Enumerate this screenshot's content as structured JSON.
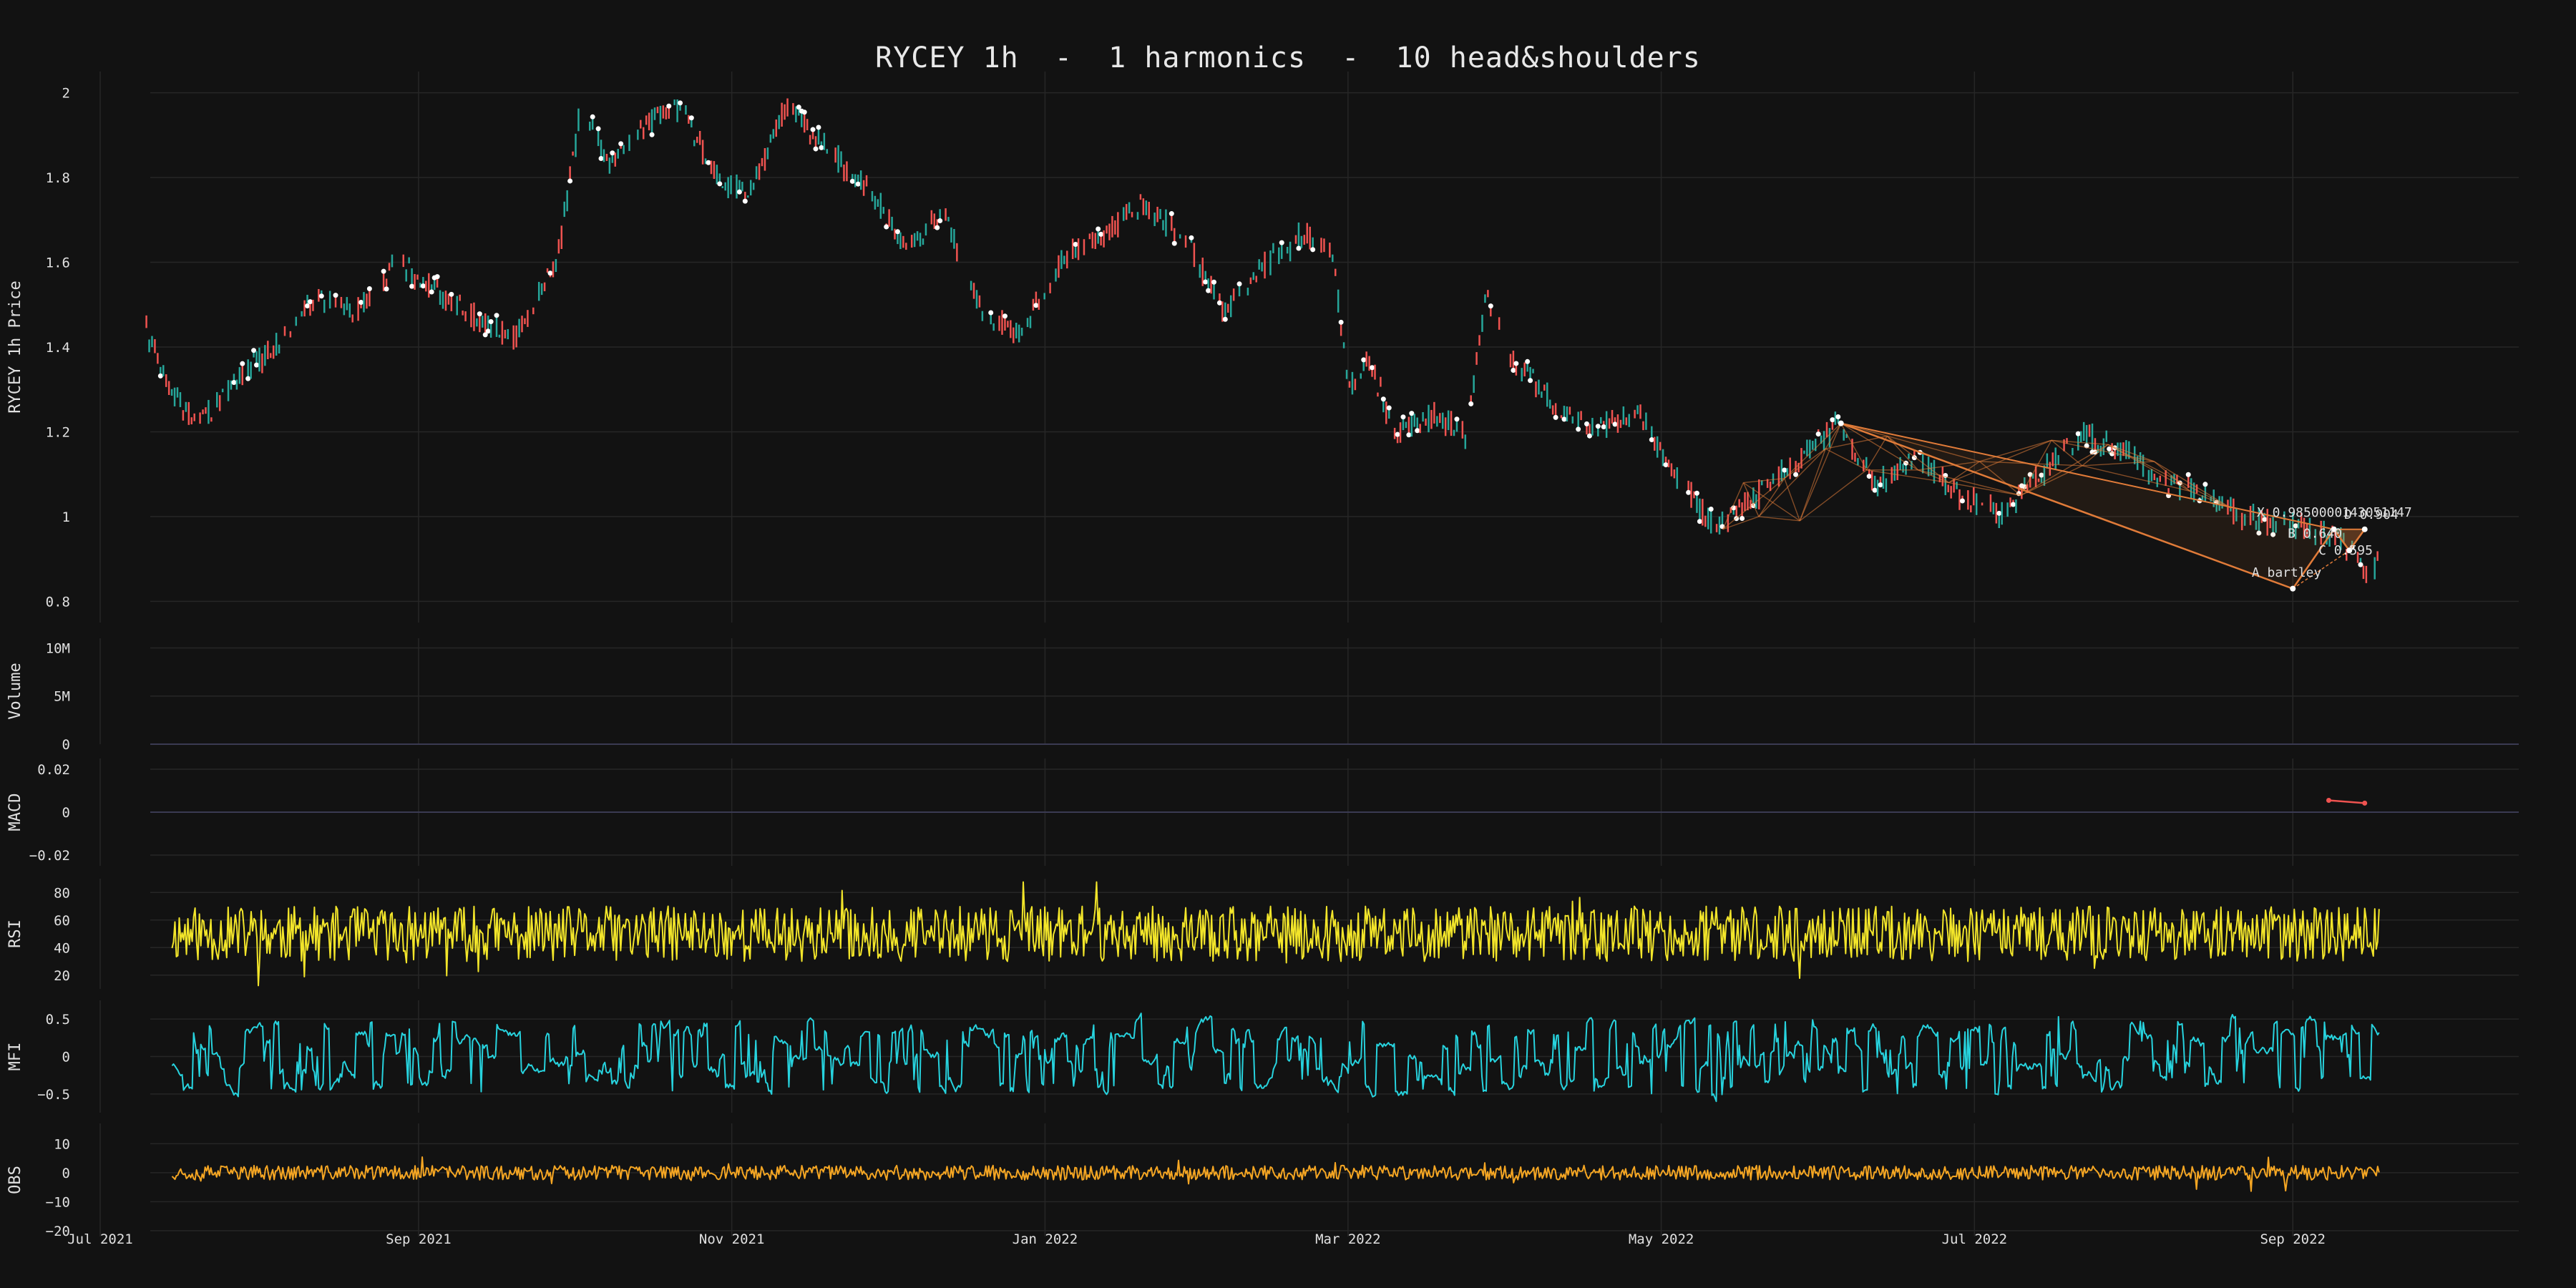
{
  "chart_data": {
    "type": "line",
    "title": "RYCEY 1h  -  1 harmonics  -  10 head&shoulders",
    "x_axis": {
      "ticks": [
        "Jul 2021",
        "Sep 2021",
        "Nov 2021",
        "Jan 2022",
        "Mar 2022",
        "May 2022",
        "Jul 2022",
        "Sep 2022"
      ],
      "range": [
        "2021-07-01",
        "2022-10-15"
      ]
    },
    "grid": true,
    "colors": {
      "background": "#121212",
      "grid": "#262626",
      "text": "#e0e0e0",
      "candle_up": "#26a69a",
      "candle_down": "#ef5350",
      "pivot": "#ffffff",
      "pattern": "#e07b39",
      "macd": "#ef5350",
      "rsi": "#f2e52a",
      "mfi": "#27d3de",
      "obs": "#f5a623"
    },
    "panels": [
      {
        "id": "price",
        "ylabel": "RYCEY 1h Price",
        "ylim": [
          0.75,
          2.05
        ],
        "yticks": [
          "2",
          "1.8",
          "1.6",
          "1.4",
          "1.2",
          "1",
          "0.8"
        ],
        "ytick_values": [
          2,
          1.8,
          1.6,
          1.4,
          1.2,
          1,
          0.8
        ],
        "series": [
          {
            "type": "candles",
            "approx_close_path": [
              [
                "2021-07-10",
                1.44
              ],
              [
                "2021-07-15",
                1.3
              ],
              [
                "2021-07-20",
                1.21
              ],
              [
                "2021-07-28",
                1.33
              ],
              [
                "2021-08-05",
                1.41
              ],
              [
                "2021-08-12",
                1.52
              ],
              [
                "2021-08-20",
                1.48
              ],
              [
                "2021-08-28",
                1.6
              ],
              [
                "2021-09-05",
                1.53
              ],
              [
                "2021-09-12",
                1.47
              ],
              [
                "2021-09-20",
                1.43
              ],
              [
                "2021-09-28",
                1.6
              ],
              [
                "2021-10-03",
                1.99
              ],
              [
                "2021-10-08",
                1.83
              ],
              [
                "2021-10-15",
                1.93
              ],
              [
                "2021-10-22",
                1.96
              ],
              [
                "2021-10-30",
                1.79
              ],
              [
                "2021-11-05",
                1.77
              ],
              [
                "2021-11-12",
                1.98
              ],
              [
                "2021-11-20",
                1.86
              ],
              [
                "2021-11-28",
                1.77
              ],
              [
                "2021-12-05",
                1.63
              ],
              [
                "2021-12-12",
                1.72
              ],
              [
                "2021-12-20",
                1.48
              ],
              [
                "2021-12-27",
                1.43
              ],
              [
                "2022-01-05",
                1.62
              ],
              [
                "2022-01-12",
                1.66
              ],
              [
                "2022-01-20",
                1.74
              ],
              [
                "2022-01-28",
                1.66
              ],
              [
                "2022-02-05",
                1.48
              ],
              [
                "2022-02-12",
                1.59
              ],
              [
                "2022-02-20",
                1.66
              ],
              [
                "2022-02-26",
                1.63
              ],
              [
                "2022-03-01",
                1.3
              ],
              [
                "2022-03-05",
                1.38
              ],
              [
                "2022-03-10",
                1.2
              ],
              [
                "2022-03-18",
                1.24
              ],
              [
                "2022-03-24",
                1.19
              ],
              [
                "2022-03-28",
                1.53
              ],
              [
                "2022-04-02",
                1.37
              ],
              [
                "2022-04-10",
                1.27
              ],
              [
                "2022-04-18",
                1.2
              ],
              [
                "2022-04-26",
                1.25
              ],
              [
                "2022-05-04",
                1.09
              ],
              [
                "2022-05-12",
                0.97
              ],
              [
                "2022-05-20",
                1.05
              ],
              [
                "2022-05-28",
                1.14
              ],
              [
                "2022-06-04",
                1.21
              ],
              [
                "2022-06-12",
                1.08
              ],
              [
                "2022-06-20",
                1.14
              ],
              [
                "2022-06-28",
                1.05
              ],
              [
                "2022-07-06",
                1.01
              ],
              [
                "2022-07-14",
                1.1
              ],
              [
                "2022-07-22",
                1.19
              ],
              [
                "2022-07-30",
                1.16
              ],
              [
                "2022-08-07",
                1.08
              ],
              [
                "2022-08-15",
                1.06
              ],
              [
                "2022-08-22",
                1.0
              ],
              [
                "2022-08-30",
                0.98
              ],
              [
                "2022-09-05",
                0.97
              ],
              [
                "2022-09-10",
                0.95
              ],
              [
                "2022-09-16",
                0.87
              ],
              [
                "2022-09-18",
                0.9
              ]
            ]
          },
          {
            "type": "harmonic_pattern",
            "name": "bartley",
            "points": [
              {
                "label": "X",
                "x": "2022-06-05",
                "y": 1.22
              },
              {
                "label": "A",
                "x": "2022-09-01",
                "y": 0.83
              },
              {
                "label": "B",
                "x": "2022-09-09",
                "y": 0.97
              },
              {
                "label": "C",
                "x": "2022-09-12",
                "y": 0.92
              },
              {
                "label": "D",
                "x": "2022-09-15",
                "y": 0.97
              }
            ],
            "labels": [
              {
                "text": "X 0.9850000143051147",
                "x": "2022-08-25",
                "y": 1.0
              },
              {
                "text": "D 0.904",
                "x": "2022-09-11",
                "y": 0.995
              },
              {
                "text": "B 0.640",
                "x": "2022-08-31",
                "y": 0.95
              },
              {
                "text": "C 0.595",
                "x": "2022-09-06",
                "y": 0.91
              },
              {
                "text": "A bartley",
                "x": "2022-08-24",
                "y": 0.858
              }
            ]
          },
          {
            "type": "head_shoulders_lines",
            "zigzag": [
              [
                "2022-05-13",
                0.97
              ],
              [
                "2022-05-17",
                1.08
              ],
              [
                "2022-05-20",
                1.0
              ],
              [
                "2022-05-25",
                1.09
              ],
              [
                "2022-05-28",
                0.99
              ],
              [
                "2022-06-02",
                1.16
              ],
              [
                "2022-06-05",
                1.22
              ],
              [
                "2022-06-10",
                1.11
              ],
              [
                "2022-06-14",
                1.19
              ],
              [
                "2022-06-20",
                1.11
              ],
              [
                "2022-06-26",
                1.08
              ],
              [
                "2022-07-02",
                1.13
              ],
              [
                "2022-07-10",
                1.05
              ],
              [
                "2022-07-16",
                1.18
              ],
              [
                "2022-07-22",
                1.12
              ],
              [
                "2022-07-27",
                1.17
              ],
              [
                "2022-08-05",
                1.13
              ],
              [
                "2022-08-12",
                1.06
              ],
              [
                "2022-08-20",
                1.02
              ]
            ]
          }
        ]
      },
      {
        "id": "volume",
        "ylabel": "Volume",
        "yticks": [
          "10M",
          "5M",
          "0"
        ],
        "ytick_values": [
          10,
          5,
          0
        ],
        "ylim": [
          0,
          11
        ]
      },
      {
        "id": "macd",
        "ylabel": "MACD",
        "yticks": [
          "0.02",
          "0",
          "−0.02"
        ],
        "ytick_values": [
          0.02,
          0,
          -0.02
        ],
        "ylim": [
          -0.025,
          0.025
        ],
        "series": [
          {
            "name": "",
            "values": [
              [
                "2022-09-08",
                0.0055
              ],
              [
                "2022-09-15",
                0.0042
              ]
            ]
          }
        ]
      },
      {
        "id": "rsi",
        "ylabel": "RSI",
        "yticks": [
          "80",
          "60",
          "40",
          "20"
        ],
        "ytick_values": [
          80,
          60,
          40,
          20
        ],
        "ylim": [
          10,
          90
        ],
        "series": [
          {
            "name": "",
            "mean": 50,
            "amplitude": 20,
            "seed": 11
          }
        ]
      },
      {
        "id": "mfi",
        "ylabel": "MFI",
        "yticks": [
          "0.5",
          "0",
          "−0.5"
        ],
        "ytick_values": [
          0.5,
          0,
          -0.5
        ],
        "ylim": [
          -0.75,
          0.75
        ],
        "series": [
          {
            "name": "",
            "mean": 0,
            "amplitude": 0.3,
            "seed": 23
          }
        ]
      },
      {
        "id": "obs",
        "ylabel": "OBS",
        "yticks": [
          "10",
          "0",
          "−10",
          "−20"
        ],
        "ytick_values": [
          10,
          0,
          -10,
          -20
        ],
        "ylim": [
          -22,
          17
        ],
        "series": [
          {
            "name": "",
            "mean": 0,
            "amplitude": 2.5,
            "seed": 37
          }
        ]
      }
    ]
  }
}
